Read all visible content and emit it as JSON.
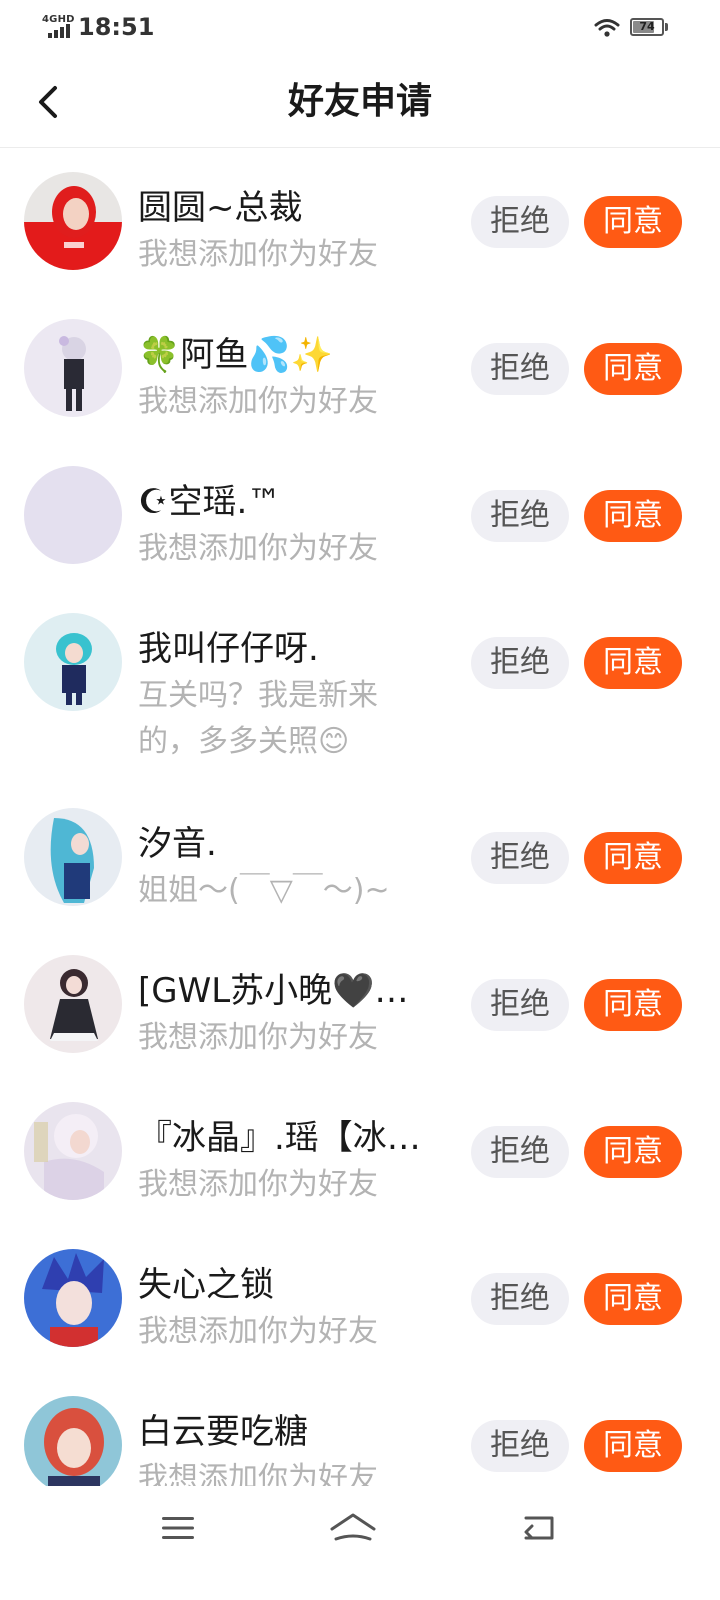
{
  "status_bar": {
    "network": "4GHD",
    "time": "18:51",
    "battery_level": 74,
    "battery_text": "74"
  },
  "header": {
    "title": "好友申请"
  },
  "actions": {
    "reject_label": "拒绝",
    "accept_label": "同意"
  },
  "requests": [
    {
      "name": "圆圆~总裁",
      "message": "我想添加你为好友",
      "avatar": "red-outfit-avatar"
    },
    {
      "name": "🍀阿鱼💦✨",
      "message": "我想添加你为好友",
      "avatar": "pastel-character-avatar"
    },
    {
      "name": "☪空瑶.™",
      "message": "我想添加你为好友",
      "avatar": "blank-lavender-avatar"
    },
    {
      "name": "我叫仔仔呀.",
      "message": "互关吗？我是新来的，多多关照😊",
      "avatar": "teal-hair-character-avatar"
    },
    {
      "name": "汐音.",
      "message": "姐姐～(￣▽￣～)~",
      "avatar": "blue-hair-character-avatar"
    },
    {
      "name": "[GWL苏小晚🖤…",
      "message": "我想添加你为好友",
      "avatar": "gothic-dress-character-avatar"
    },
    {
      "name": "『冰晶』.瑶【冰…",
      "message": "我想添加你为好友",
      "avatar": "white-hair-character-avatar"
    },
    {
      "name": "失心之锁",
      "message": "我想添加你为好友",
      "avatar": "blue-spiky-hair-avatar"
    },
    {
      "name": "白云要吃糖",
      "message": "我想添加你为好友",
      "avatar": "red-hair-character-avatar"
    }
  ],
  "colors": {
    "accept": "#ff5a14",
    "reject_bg": "#efeff4",
    "message_text": "#b3b3b3"
  },
  "nav_icons": [
    "menu-icon",
    "home-icon",
    "back-icon"
  ]
}
